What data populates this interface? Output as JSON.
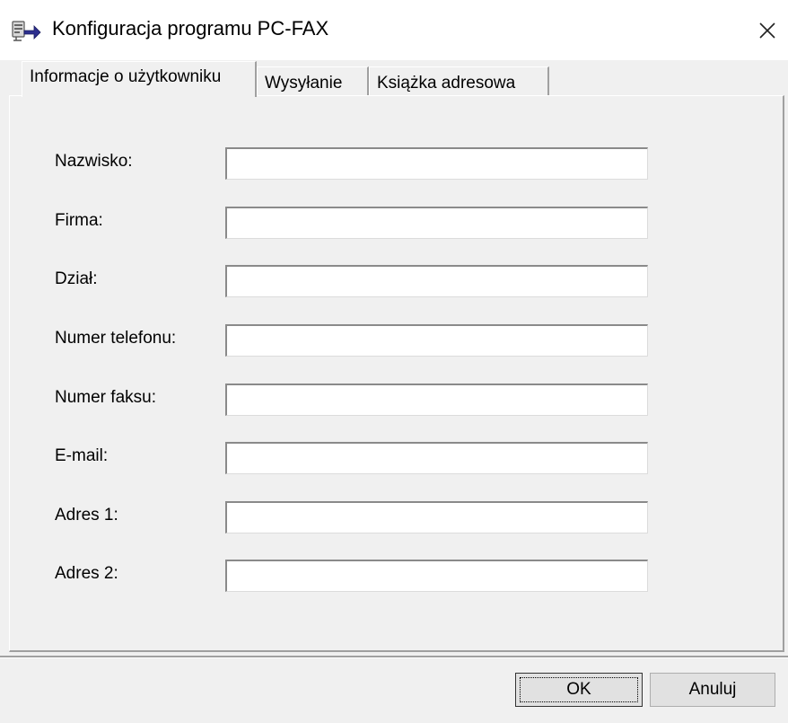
{
  "window": {
    "title": "Konfiguracja programu PC-FAX",
    "icon": "fax-program-icon",
    "close_icon": "close-icon"
  },
  "tabs": [
    {
      "label": "Informacje o użytkowniku",
      "active": true
    },
    {
      "label": "Wysyłanie",
      "active": false
    },
    {
      "label": "Książka adresowa",
      "active": false
    }
  ],
  "form": {
    "fields": [
      {
        "label": "Nazwisko:",
        "value": ""
      },
      {
        "label": "Firma:",
        "value": ""
      },
      {
        "label": "Dział:",
        "value": ""
      },
      {
        "label": "Numer telefonu:",
        "value": ""
      },
      {
        "label": "Numer faksu:",
        "value": ""
      },
      {
        "label": "E-mail:",
        "value": ""
      },
      {
        "label": "Adres 1:",
        "value": ""
      },
      {
        "label": "Adres 2:",
        "value": ""
      }
    ]
  },
  "buttons": {
    "ok": "OK",
    "cancel": "Anuluj"
  }
}
